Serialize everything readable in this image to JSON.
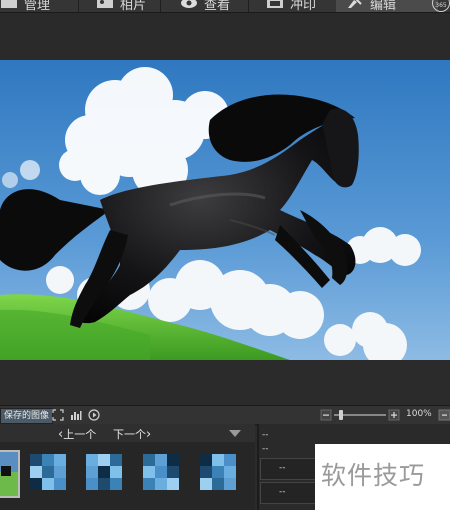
{
  "top_tabs": [
    {
      "label": "管理",
      "icon": "folder-icon"
    },
    {
      "label": "相片",
      "icon": "photo-icon"
    },
    {
      "label": "查看",
      "icon": "eye-icon"
    },
    {
      "label": "冲印",
      "icon": "print-icon"
    },
    {
      "label": "编辑",
      "icon": "edit-icon",
      "active": true
    },
    {
      "label": "365",
      "icon": "365-badge-icon"
    }
  ],
  "toolbar": {
    "saved_images_label": "保存的图像",
    "zoom_value": "100%",
    "zoom_level": 0.1
  },
  "navigator": {
    "prev_label": "上一个",
    "next_label": "下一个"
  },
  "info_panel": {
    "line1": "--",
    "line2": "--",
    "field1": "--",
    "field2": "--"
  },
  "watermark": {
    "text": "软件技巧"
  },
  "colors": {
    "background": "#2b2b2b",
    "sky": "#3f86c8",
    "grass": "#5bc238",
    "selected_tab": "#4b4b4b"
  }
}
